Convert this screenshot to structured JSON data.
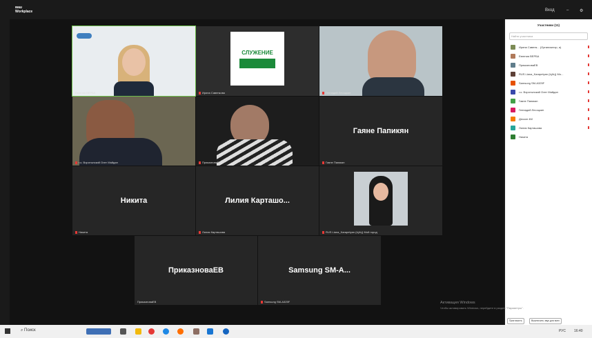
{
  "app": {
    "title_line1": "ваш",
    "title_line2": "Workplace",
    "login": "Вход"
  },
  "panel": {
    "title": "Участники (11)",
    "search_placeholder": "Найти участника",
    "invite": "Пригласить",
    "mute_all": "Выключить звук для всех"
  },
  "participants": [
    {
      "name": "Ирина Савенк... (Организатор, я)",
      "color": "#7c8b55"
    },
    {
      "name": "Евгения ВЕРБА",
      "color": "#b07a5a"
    },
    {
      "name": "ПриказноваЕВ",
      "color": "#607d8b"
    },
    {
      "name": "RUS Liana_Karapetyan (ЦАЦ) Мо...",
      "color": "#5d4037"
    },
    {
      "name": "Samsung SM-A325F",
      "color": "#e65100"
    },
    {
      "name": "г.о. Воротынский Олег Майдан",
      "color": "#3949ab"
    },
    {
      "name": "Гаяне Папикян",
      "color": "#43a047"
    },
    {
      "name": "Геннадий Лесоцкин",
      "color": "#d81b60"
    },
    {
      "name": "Дескоп 4M",
      "color": "#f57c00"
    },
    {
      "name": "Лилия Карташова",
      "color": "#26a69a"
    },
    {
      "name": "Никита",
      "color": "#2e7d32"
    }
  ],
  "tiles": {
    "t1": {
      "label": "Евгения ВЕРБА"
    },
    "t2": {
      "label": "Ирина Савенкова",
      "logo_text": "СЛУЖЕНИЕ"
    },
    "t3": {
      "label": "Геннадий Лесоцкин"
    },
    "t4": {
      "label": "г.о. Воротынский Олег Майдан"
    },
    "t5": {
      "label": "ПриказноваЕВ"
    },
    "t6": {
      "name": "Гаяне Папикян",
      "label": "Гаяне Папикян"
    },
    "t7": {
      "name": "Никита",
      "label": "Никита"
    },
    "t8": {
      "name": "Лилия Карташо...",
      "label": "Лилия Карташова"
    },
    "t9": {
      "label": "RUS Liana_Karapetyan (ЦАЦ) Мой город"
    },
    "t10": {
      "name": "ПриказноваЕВ",
      "label": "ПриказноваЕВ"
    },
    "t11": {
      "name": "Samsung SM-A...",
      "label": "Samsung SM-A325F"
    }
  },
  "activation": {
    "title": "Активация Windows",
    "sub": "Чтобы активировать Windows, перейдите в раздел \"Параметры\"."
  },
  "taskbar": {
    "search": "Поиск",
    "lang": "РУС",
    "time": "16:40"
  }
}
